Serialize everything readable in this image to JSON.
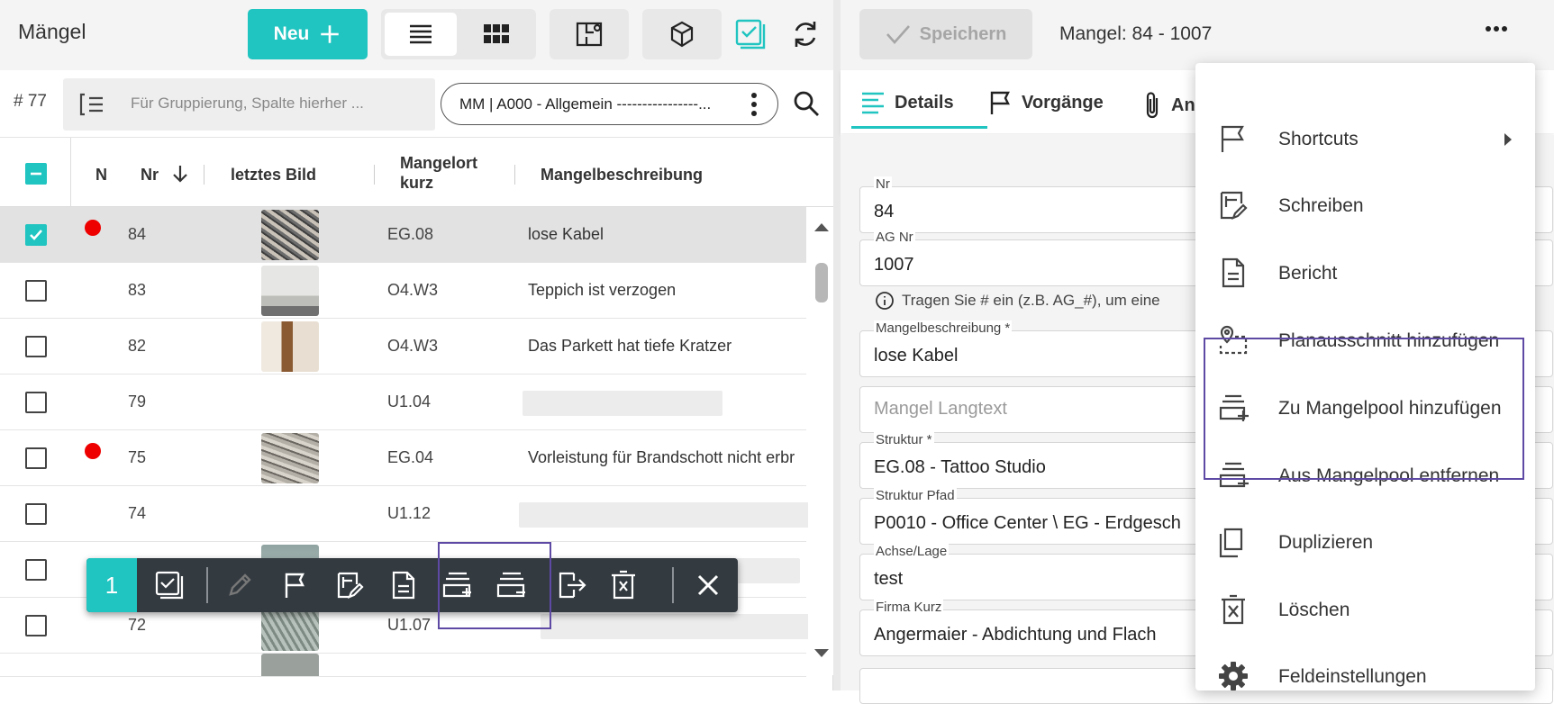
{
  "left": {
    "title": "Mängel",
    "new_button_label": "Neu",
    "count": "# 77",
    "group_placeholder": "Für Gruppierung, Spalte hierher ...",
    "filter_pill": "MM | A000 - Allgemein ----------------...",
    "columns": {
      "n": "N",
      "nr": "Nr",
      "bild": "letztes Bild",
      "ort_line1": "Mangelort",
      "ort_line2": "kurz",
      "desc": "Mangelbeschreibung"
    },
    "rows": [
      {
        "nr": "84",
        "ort": "EG.08",
        "desc": "lose Kabel",
        "red": true,
        "selected": true,
        "thumb": "cables"
      },
      {
        "nr": "83",
        "ort": "O4.W3",
        "desc": "Teppich ist verzogen",
        "red": false,
        "selected": false,
        "thumb": "wall"
      },
      {
        "nr": "82",
        "ort": "O4.W3",
        "desc": "Das Parkett hat tiefe Kratzer",
        "red": false,
        "selected": false,
        "thumb": "floor"
      },
      {
        "nr": "79",
        "ort": "U1.04",
        "desc": "",
        "red": false,
        "selected": false,
        "thumb": ""
      },
      {
        "nr": "75",
        "ort": "EG.04",
        "desc": "Vorleistung für Brandschott nicht erbr",
        "red": true,
        "selected": false,
        "thumb": "cables"
      },
      {
        "nr": "74",
        "ort": "U1.12",
        "desc": "",
        "red": false,
        "selected": false,
        "thumb": ""
      },
      {
        "nr": "",
        "ort": "",
        "desc": "",
        "red": false,
        "selected": false,
        "thumb": "wall"
      },
      {
        "nr": "72",
        "ort": "U1.07",
        "desc": "",
        "red": false,
        "selected": false,
        "thumb": "floor"
      }
    ],
    "action_bar": {
      "selected_count": "1"
    }
  },
  "right": {
    "save_label": "Speichern",
    "detail_title": "Mangel: 84 - 1007",
    "tabs": [
      "Details",
      "Vorgänge",
      "An"
    ],
    "fields": {
      "nr_label": "Nr",
      "nr_value": "84",
      "ag_label": "AG Nr",
      "ag_value": "1007",
      "hint": "Tragen Sie # ein (z.B. AG_#), um eine",
      "desc_label": "Mangelbeschreibung *",
      "desc_value": "lose Kabel",
      "langtext_placeholder": "Mangel Langtext",
      "struktur_label": "Struktur *",
      "struktur_value": "EG.08 - Tattoo Studio",
      "pfad_label": "Struktur Pfad",
      "pfad_value": "P0010 - Office Center \\ EG - Erdgesch",
      "achse_label": "Achse/Lage",
      "achse_value": "test",
      "firma_label": "Firma Kurz",
      "firma_value": "Angermaier - Abdichtung und Flach"
    }
  },
  "menu": {
    "items": [
      {
        "label": "Shortcuts",
        "icon": "flag-icon",
        "submenu": true
      },
      {
        "label": "Schreiben",
        "icon": "write-icon"
      },
      {
        "label": "Bericht",
        "icon": "report-icon"
      },
      {
        "label": "Planausschnitt hinzufügen",
        "icon": "plan-section-icon"
      },
      {
        "label": "Zu Mangelpool hinzufügen",
        "icon": "pool-add-icon"
      },
      {
        "label": "Aus Mangelpool entfernen",
        "icon": "pool-remove-icon"
      },
      {
        "label": "Duplizieren",
        "icon": "duplicate-icon"
      },
      {
        "label": "Löschen",
        "icon": "delete-icon"
      },
      {
        "label": "Feldeinstellungen",
        "icon": "settings-icon"
      }
    ]
  },
  "colors": {
    "accent": "#20c4c0",
    "highlight": "#5e4aa4",
    "actionbar": "#333a40",
    "reddot": "#ee0000"
  }
}
